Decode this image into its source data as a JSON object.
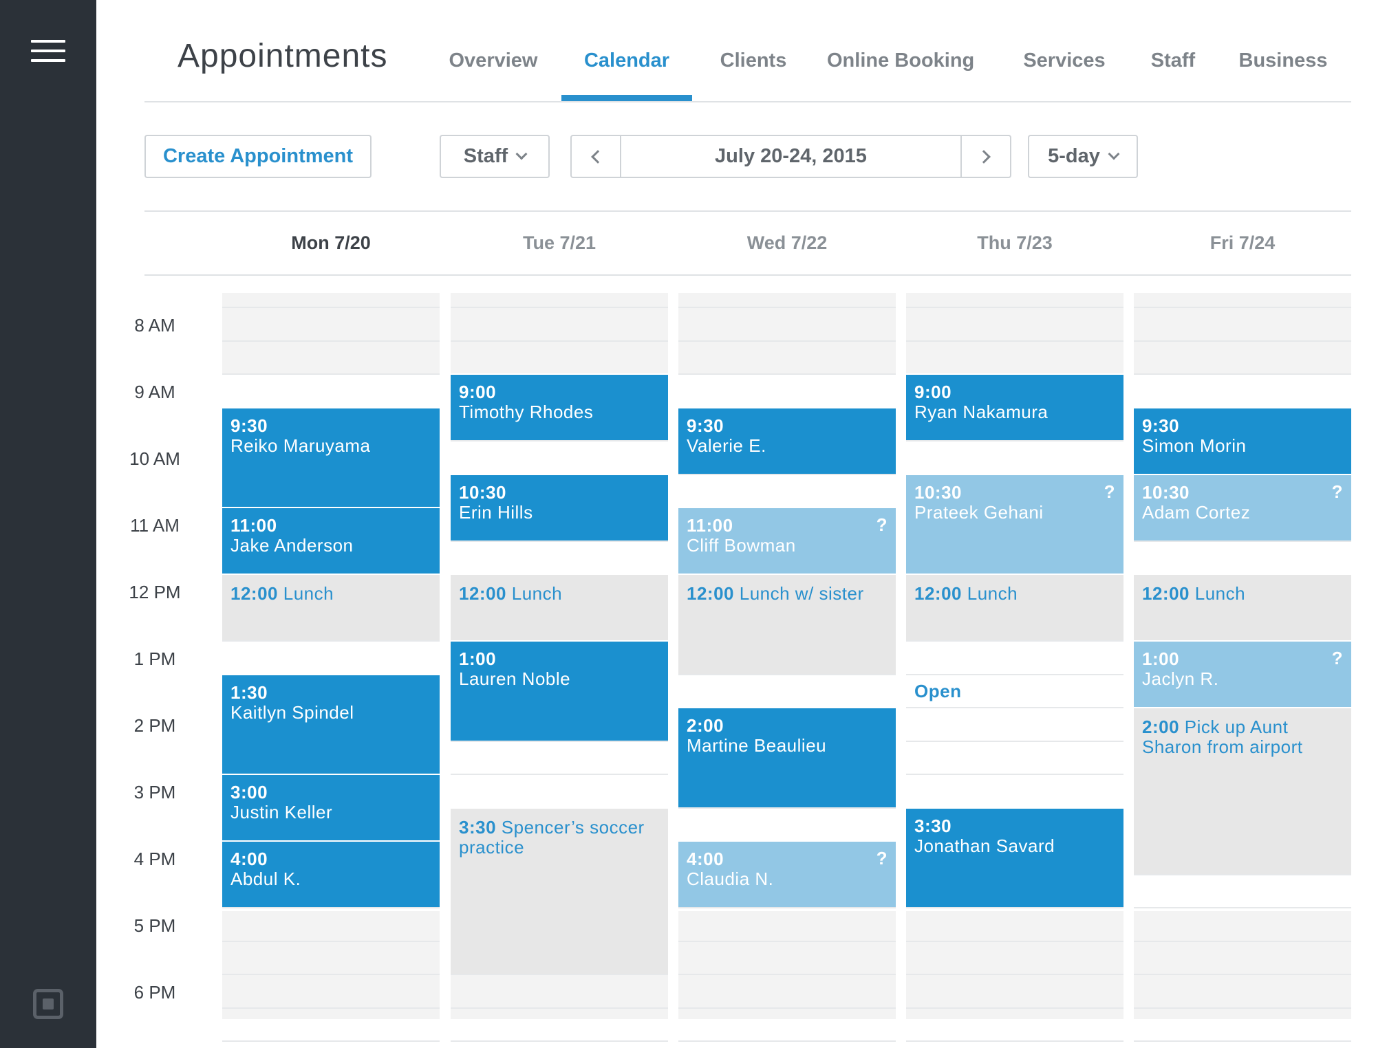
{
  "app": {
    "title": "Appointments"
  },
  "tabs": [
    {
      "label": "Overview",
      "active": false
    },
    {
      "label": "Calendar",
      "active": true
    },
    {
      "label": "Clients",
      "active": false
    },
    {
      "label": "Online Booking",
      "active": false
    },
    {
      "label": "Services",
      "active": false
    },
    {
      "label": "Staff",
      "active": false
    },
    {
      "label": "Business",
      "active": false
    }
  ],
  "toolbar": {
    "create_label": "Create Appointment",
    "staff_label": "Staff",
    "date_range": "July 20-24, 2015",
    "view_label": "5-day"
  },
  "colors": {
    "accent": "#2990cd",
    "confirmed": "#1b90cf",
    "pending": "#92c7e5",
    "block": "#e7e7e7",
    "sidebar": "#2b3138"
  },
  "icons": {
    "menu": "hamburger-menu-icon",
    "logo": "square-logo-icon",
    "prev": "chevron-left-icon",
    "next": "chevron-right-icon",
    "dropdown": "chevron-down-icon"
  },
  "time_labels": [
    "8 AM",
    "9 AM",
    "10 AM",
    "11 AM",
    "12 PM",
    "1 PM",
    "2 PM",
    "3 PM",
    "4 PM",
    "5 PM",
    "6 PM"
  ],
  "days": [
    {
      "label": "Mon 7/20",
      "today": true,
      "events": [
        {
          "time": "9:30",
          "title": "Reiko Maruyama",
          "status": "confirmed"
        },
        {
          "time": "11:00",
          "title": "Jake Anderson",
          "status": "confirmed"
        },
        {
          "time": "12:00",
          "title": "Lunch",
          "status": "block"
        },
        {
          "time": "1:30",
          "title": "Kaitlyn Spindel",
          "status": "confirmed"
        },
        {
          "time": "3:00",
          "title": "Justin Keller",
          "status": "confirmed"
        },
        {
          "time": "4:00",
          "title": "Abdul K.",
          "status": "confirmed"
        }
      ]
    },
    {
      "label": "Tue 7/21",
      "today": false,
      "events": [
        {
          "time": "9:00",
          "title": "Timothy Rhodes",
          "status": "confirmed"
        },
        {
          "time": "10:30",
          "title": "Erin Hills",
          "status": "confirmed"
        },
        {
          "time": "12:00",
          "title": "Lunch",
          "status": "block"
        },
        {
          "time": "1:00",
          "title": "Lauren Noble",
          "status": "confirmed"
        },
        {
          "time": "3:30",
          "title": "Spencer’s soccer practice",
          "status": "block"
        }
      ]
    },
    {
      "label": "Wed 7/22",
      "today": false,
      "events": [
        {
          "time": "9:30",
          "title": "Valerie E.",
          "status": "confirmed"
        },
        {
          "time": "11:00",
          "title": "Cliff Bowman",
          "status": "pending",
          "mark": "?"
        },
        {
          "time": "12:00",
          "title": "Lunch w/ sister",
          "status": "block"
        },
        {
          "time": "2:00",
          "title": "Martine Beaulieu",
          "status": "confirmed"
        },
        {
          "time": "4:00",
          "title": "Claudia N.",
          "status": "pending",
          "mark": "?"
        }
      ]
    },
    {
      "label": "Thu 7/23",
      "today": false,
      "events": [
        {
          "time": "9:00",
          "title": "Ryan Nakamura",
          "status": "confirmed"
        },
        {
          "time": "10:30",
          "title": "Prateek Gehani",
          "status": "pending",
          "mark": "?"
        },
        {
          "time": "12:00",
          "title": "Lunch",
          "status": "block"
        },
        {
          "time": "Open",
          "title": "",
          "status": "open"
        },
        {
          "time": "3:30",
          "title": "Jonathan Savard",
          "status": "confirmed"
        }
      ]
    },
    {
      "label": "Fri 7/24",
      "today": false,
      "events": [
        {
          "time": "9:30",
          "title": "Simon Morin",
          "status": "confirmed"
        },
        {
          "time": "10:30",
          "title": "Adam Cortez",
          "status": "pending",
          "mark": "?"
        },
        {
          "time": "12:00",
          "title": "Lunch",
          "status": "block"
        },
        {
          "time": "1:00",
          "title": "Jaclyn R.",
          "status": "pending",
          "mark": "?"
        },
        {
          "time": "2:00",
          "title": "Pick up Aunt Sharon from airport",
          "status": "block"
        }
      ]
    }
  ]
}
